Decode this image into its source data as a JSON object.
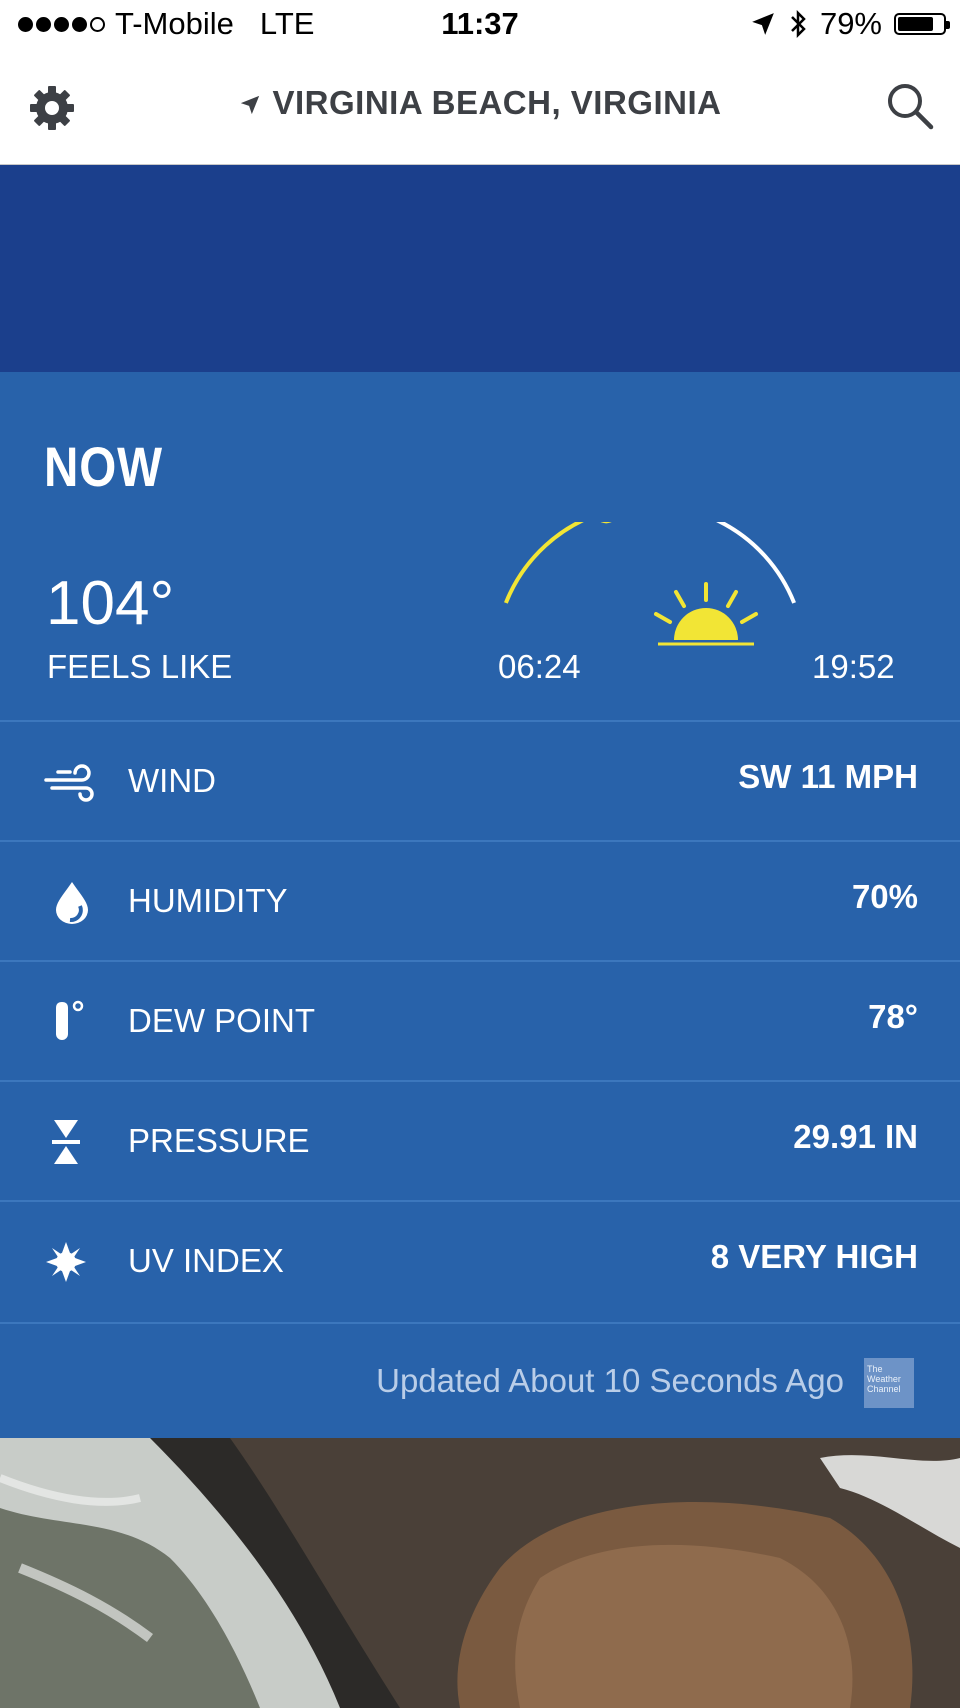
{
  "status_bar": {
    "carrier": "T-Mobile",
    "network": "LTE",
    "time": "11:37",
    "battery": "79%",
    "battery_level": 0.79,
    "icons": [
      "signal-dots-icon",
      "location-arrow-icon",
      "bluetooth-icon",
      "battery-icon"
    ]
  },
  "nav": {
    "location": "VIRGINIA BEACH, VIRGINIA",
    "icons": [
      "gear-icon",
      "location-arrow-icon",
      "search-icon"
    ]
  },
  "now": {
    "title": "NOW",
    "feels_like_temp": "104°",
    "feels_like_label": "FEELS LIKE",
    "sunrise": "06:24",
    "sunset": "19:52",
    "sun_progress": 0.38
  },
  "conditions": [
    {
      "icon": "wind-icon",
      "label": "WIND",
      "value": "SW 11 MPH"
    },
    {
      "icon": "droplet-icon",
      "label": "HUMIDITY",
      "value": "70%"
    },
    {
      "icon": "thermometer-icon",
      "label": "DEW POINT",
      "value": "78°"
    },
    {
      "icon": "pressure-icon",
      "label": "PRESSURE",
      "value": "29.91 IN"
    },
    {
      "icon": "uv-sun-icon",
      "label": "UV INDEX",
      "value": "8 VERY HIGH"
    }
  ],
  "footer": {
    "updated": "Updated About 10 Seconds Ago",
    "logo_text": "The Weather Channel"
  },
  "colors": {
    "banner": "#1b3f8c",
    "panel": "#2862aa",
    "sun": "#f2e535"
  }
}
